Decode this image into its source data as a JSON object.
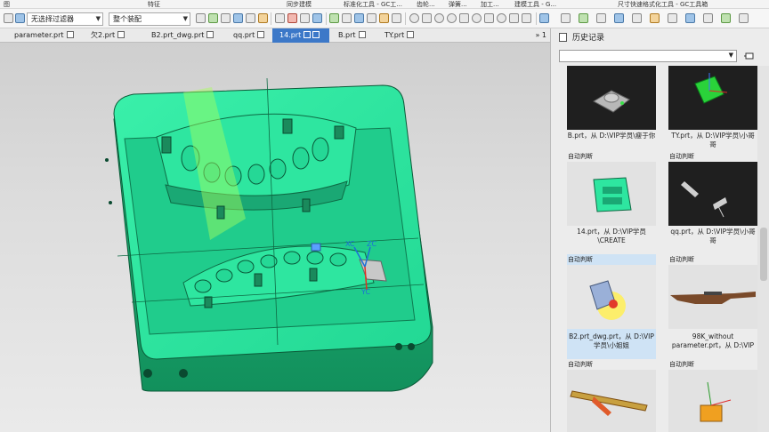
{
  "ribbon": {
    "groups": [
      "图",
      "特征",
      "同步建模",
      "标准化工具 - GC工...",
      "齿轮...",
      "弹簧...",
      "加工...",
      "建模工具 - G...",
      "尺寸快速格式化工具 - GC工具箱"
    ]
  },
  "toolbar": {
    "filter_value": "无选择过滤器",
    "assembly_value": "整个装配"
  },
  "tabs": [
    {
      "label": "parameter.prt",
      "active": false
    },
    {
      "label": "欠2.prt",
      "active": false
    },
    {
      "label": "B2.prt_dwg.prt",
      "active": false
    },
    {
      "label": "qq.prt",
      "active": false
    },
    {
      "label": "14.prt",
      "active": true
    },
    {
      "label": "B.prt",
      "active": false
    },
    {
      "label": "TY.prt",
      "active": false
    }
  ],
  "tab_count": "» 1",
  "viewport": {
    "csys": {
      "x": "XC",
      "y": "YC",
      "z": "ZC"
    }
  },
  "history": {
    "title": "历史记录",
    "combo_value": "",
    "items": [
      {
        "region": "",
        "caption": "B.prt，从 D:\\VIP学员\\瘦于你"
      },
      {
        "region": "",
        "caption": "TY.prt，从 D:\\VIP学员\\小哥哥"
      },
      {
        "region": "自动判断",
        "caption": "14.prt，从 D:\\VIP学员\\CREATE"
      },
      {
        "region": "自动判断",
        "caption": "qq.prt，从 D:\\VIP学员\\小哥哥"
      },
      {
        "region": "自动判断",
        "caption": "B2.prt_dwg.prt，从 D:\\VIP学员\\小姐姐"
      },
      {
        "region": "自动判断",
        "caption": "98K_without parameter.prt，从 D:\\VIP"
      },
      {
        "region": "自动判断",
        "caption": ""
      },
      {
        "region": "自动判断",
        "caption": ""
      }
    ]
  },
  "colors": {
    "part_green": "#2ee6a0",
    "part_dark": "#0f7a4f",
    "tab_active": "#3c78c8",
    "selection": "#cfe3f5",
    "accent_yellow": "#ffee55"
  }
}
